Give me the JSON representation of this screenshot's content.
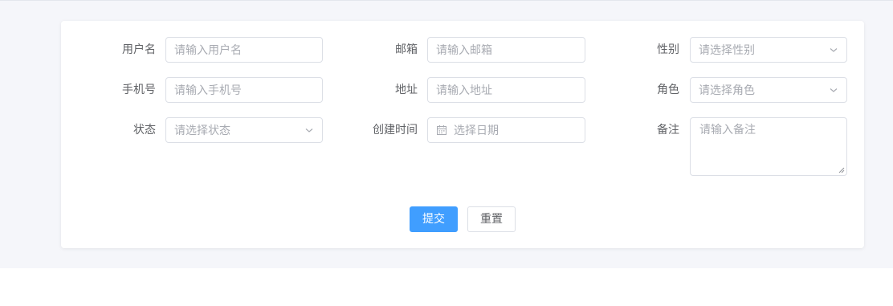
{
  "form": {
    "username": {
      "label": "用户名",
      "placeholder": "请输入用户名"
    },
    "email": {
      "label": "邮箱",
      "placeholder": "请输入邮箱"
    },
    "gender": {
      "label": "性别",
      "placeholder": "请选择性别"
    },
    "phone": {
      "label": "手机号",
      "placeholder": "请输入手机号"
    },
    "address": {
      "label": "地址",
      "placeholder": "请输入地址"
    },
    "role": {
      "label": "角色",
      "placeholder": "请选择角色"
    },
    "status": {
      "label": "状态",
      "placeholder": "请选择状态"
    },
    "created_time": {
      "label": "创建时间",
      "placeholder": "选择日期"
    },
    "remark": {
      "label": "备注",
      "placeholder": "请输入备注"
    }
  },
  "actions": {
    "submit_label": "提交",
    "reset_label": "重置"
  },
  "colors": {
    "primary": "#409eff",
    "border": "#dcdfe6",
    "placeholder": "#a8abb2",
    "label": "#606266",
    "page_bg": "#f5f6fa"
  },
  "icons": {
    "select_arrow": "chevron-down-icon",
    "date_picker": "calendar-icon"
  }
}
